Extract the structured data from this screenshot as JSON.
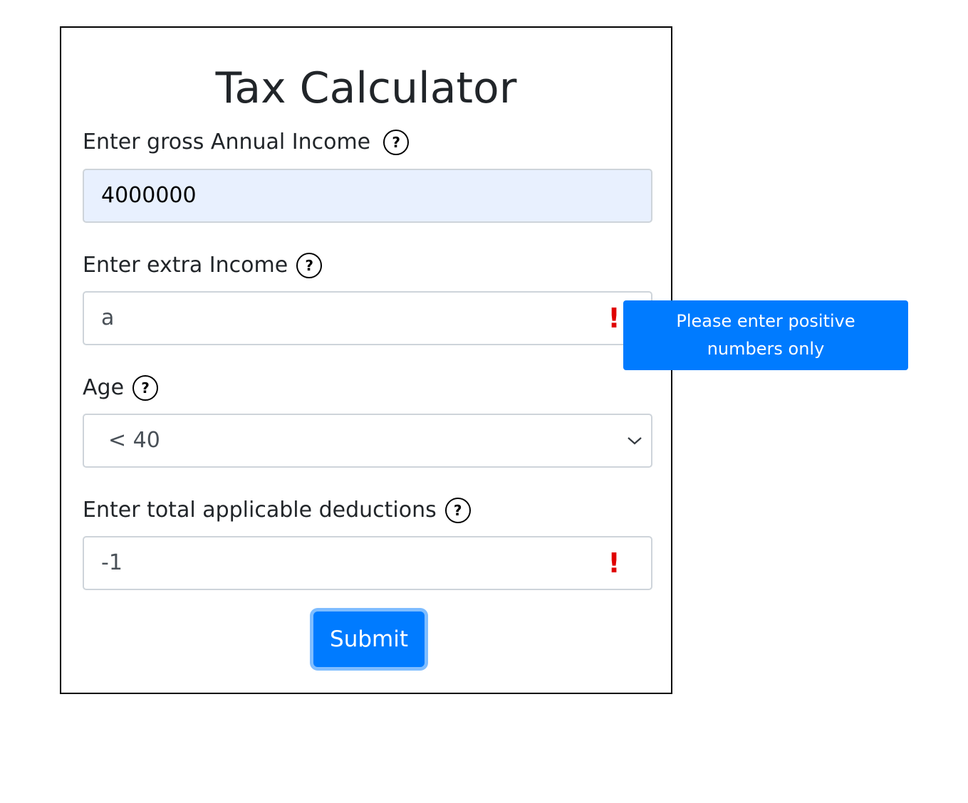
{
  "form": {
    "title": "Tax Calculator",
    "gross_income": {
      "label": "Enter gross Annual Income",
      "value": "4000000",
      "help_icon": "question-circle-icon"
    },
    "extra_income": {
      "label": "Enter extra Income",
      "value": "a",
      "error_mark": "!",
      "help_icon": "question-circle-icon"
    },
    "age": {
      "label": "Age",
      "selected": "< 40",
      "help_icon": "question-circle-icon"
    },
    "deductions": {
      "label": "Enter total applicable deductions",
      "value": "-1",
      "error_mark": "!",
      "help_icon": "question-circle-icon"
    },
    "help_glyph": "?",
    "submit_label": "Submit"
  },
  "tooltip": {
    "text": "Please enter positive numbers only"
  },
  "colors": {
    "accent": "#007bff",
    "error": "#e00000",
    "autofill_bg": "#e8f0fe"
  }
}
